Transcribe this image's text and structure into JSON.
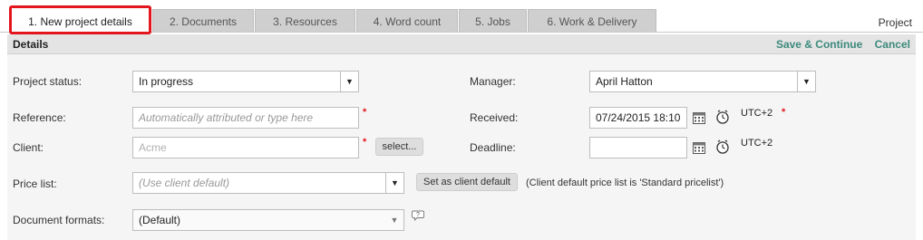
{
  "tabs": [
    {
      "label": "1. New project details"
    },
    {
      "label": "2. Documents"
    },
    {
      "label": "3. Resources"
    },
    {
      "label": "4. Word count"
    },
    {
      "label": "5. Jobs"
    },
    {
      "label": "6. Work & Delivery"
    }
  ],
  "tab_right_label": "Project",
  "details": {
    "title": "Details",
    "save_label": "Save & Continue",
    "cancel_label": "Cancel"
  },
  "form": {
    "project_status": {
      "label": "Project status:",
      "value": "In progress"
    },
    "reference": {
      "label": "Reference:",
      "placeholder": "Automatically attributed or type here",
      "required_mark": "*"
    },
    "client": {
      "label": "Client:",
      "placeholder": "Acme",
      "required_mark": "*",
      "select_label": "select..."
    },
    "price_list": {
      "label": "Price list:",
      "value": "(Use client default)",
      "set_default_label": "Set as client default",
      "note": "(Client default price list is 'Standard pricelist')"
    },
    "document_formats": {
      "label": "Document formats:",
      "value": "(Default)",
      "help_icon": "?"
    },
    "manager": {
      "label": "Manager:",
      "value": "April Hatton"
    },
    "received": {
      "label": "Received:",
      "value": "07/24/2015 18:10",
      "timezone": "UTC+2",
      "required_mark": "*"
    },
    "deadline": {
      "label": "Deadline:",
      "value": "",
      "timezone": "UTC+2"
    }
  },
  "colors": {
    "accent": "#3d8a7c",
    "active_tab_border": "#e3151d",
    "required": "#e3151d"
  }
}
